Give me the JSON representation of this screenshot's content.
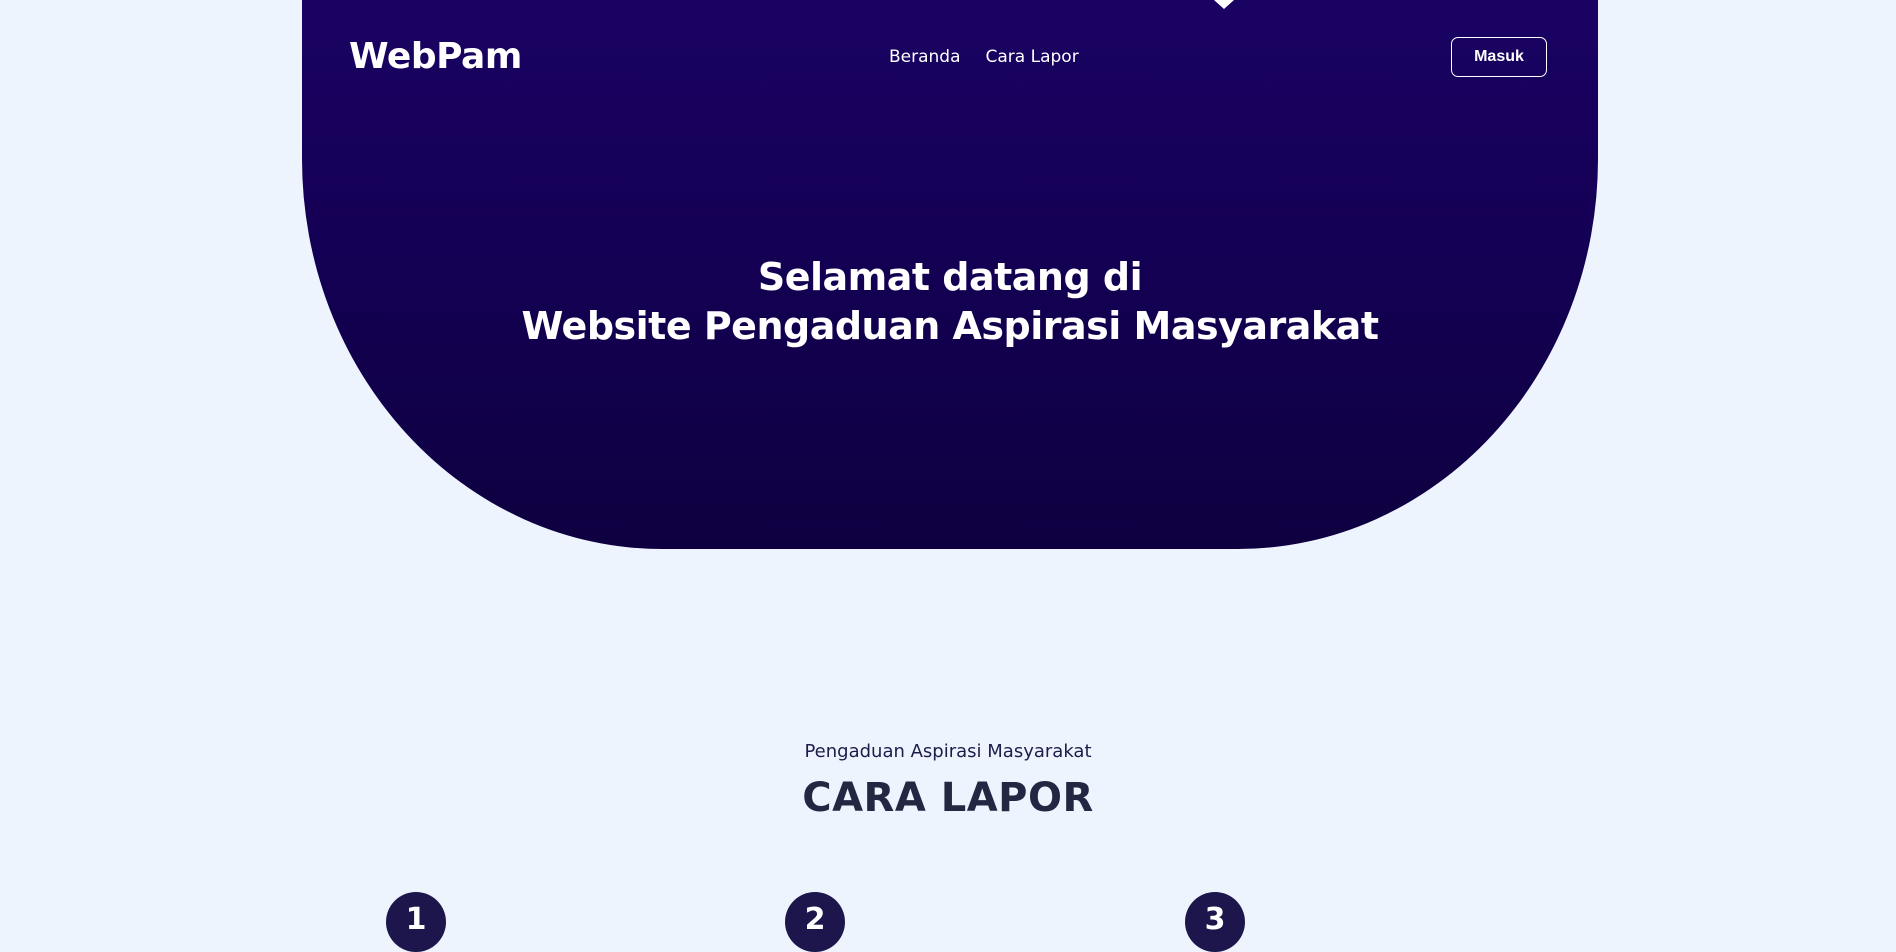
{
  "header": {
    "logo": "WebPam",
    "nav": [
      "Beranda",
      "Cara Lapor"
    ],
    "login_label": "Masuk"
  },
  "hero": {
    "title_line1": "Selamat datang di",
    "title_line2": "Website Pengaduan Aspirasi Masyarakat"
  },
  "section": {
    "subtitle": "Pengaduan Aspirasi Masyarakat",
    "title": "CARA LAPOR"
  },
  "steps": [
    "1",
    "2",
    "3"
  ],
  "colors": {
    "hero_bg": "#140054",
    "page_bg": "#eef4fe",
    "step_badge": "#1c164c",
    "heading": "#232842"
  }
}
